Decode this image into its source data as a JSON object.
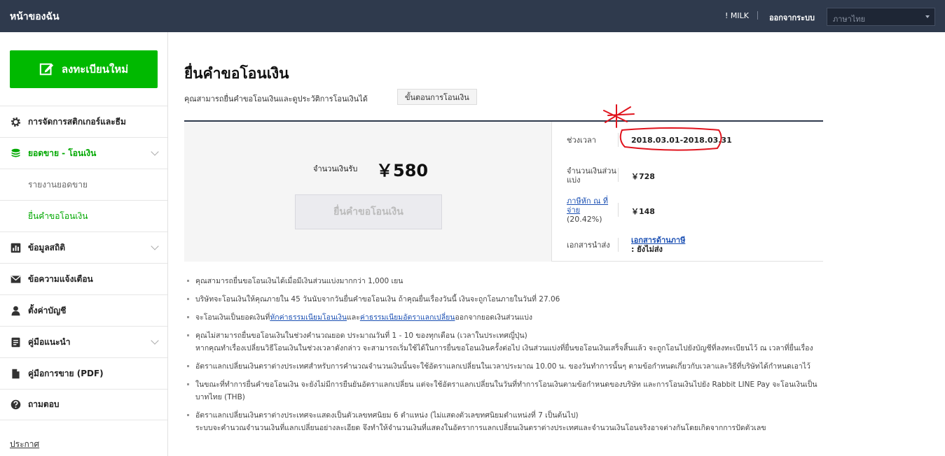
{
  "header": {
    "brand": "หน้าของฉัน",
    "user": "! MILK",
    "logout": "ออกจากระบบ",
    "language_placeholder": "ภาษาไทย"
  },
  "sidebar": {
    "register_label": "ลงทะเบียนใหม่",
    "items": [
      {
        "label": "การจัดการสติกเกอร์และธีม",
        "icon": "gear-icon"
      },
      {
        "label": "ยอดขาย - โอนเงิน",
        "icon": "coins-icon"
      },
      {
        "label": "รายงานยอดขาย"
      },
      {
        "label": "ยื่นคำขอโอนเงิน"
      },
      {
        "label": "ข้อมูลสถิติ",
        "icon": "bar-chart-icon"
      },
      {
        "label": "ข้อความแจ้งเตือน",
        "icon": "envelope-icon"
      },
      {
        "label": "ตั้งค่าบัญชี",
        "icon": "person-icon"
      },
      {
        "label": "คู่มือแนะนำ",
        "icon": "document-icon"
      },
      {
        "label": "คู่มือการขาย (PDF)",
        "icon": "file-icon"
      },
      {
        "label": "ถามตอบ",
        "icon": "question-icon"
      }
    ],
    "announcement": "ประกาศ"
  },
  "main": {
    "title": "ยื่นคำขอโอนเงิน",
    "description": "คุณสามารถยื่นคำขอโอนเงินและดูประวัติการโอนเงินได้",
    "steps_button": "ขั้นตอนการโอนเงิน",
    "summary": {
      "amount_label": "จำนวนเงินรับ",
      "amount_value": "￥580",
      "withdraw_button": "ยื่นคำขอโอนเงิน",
      "period_label": "ช่วงเวลา",
      "period_value": "2018.03.01-2018.03.31",
      "share_label": "จำนวนเงินส่วนแบ่ง",
      "share_value": "￥728",
      "tax_label": "ภาษีหัก ณ ที่จ่าย",
      "tax_rate": "(20.42%)",
      "tax_value": "￥148",
      "documents_label": "เอกสารนำส่ง",
      "documents_link": "เอกสารด้านภาษี",
      "documents_status": ": ยังไม่ส่ง"
    },
    "notes": [
      {
        "text": "คุณสามารถยื่นขอโอนเงินได้เมื่อมีเงินส่วนแบ่งมากกว่า 1,000 เยน"
      },
      {
        "text": "บริษัทจะโอนเงินให้คุณภายใน 45 วันนับจากวันยื่นคำขอโอนเงิน ถ้าคุณยื่นเรื่องวันนี้ เงินจะถูกโอนภายในวันที่ 27.06"
      },
      {
        "pre": "จะโอนเงินเป็นยอดเงินที่",
        "link1": "หักค่าธรรมเนียมโอนเงิน",
        "mid": "และ",
        "link2": "ค่าธรรมเนียมอัตราแลกเปลี่ยน",
        "post": "ออกจากยอดเงินส่วนแบ่ง"
      },
      {
        "line1": "คุณไม่สามารถยื่นขอโอนเงินในช่วงคำนวณยอด ประมาณวันที่ 1 - 10 ของทุกเดือน (เวลาในประเทศญี่ปุ่น)",
        "line2": "หากคุณทำเรื่องเปลี่ยนวิธีโอนเงินในช่วงเวลาดังกล่าว จะสามารถเริ่มใช้ได้ในการยื่นขอโอนเงินครั้งต่อไป เงินส่วนแบ่งที่ยื่นขอโอนเงินเสร็จสิ้นแล้ว จะถูกโอนไปยังบัญชีที่ลงทะเบียนไว้ ณ เวลาที่ยื่นเรื่อง"
      },
      {
        "text": "อัตราแลกเปลี่ยนเงินตราต่างประเทศสำหรับการคำนวณจำนวนเงินนั้นจะใช้อัตราแลกเปลี่ยนในเวลาประมาณ 10.00 น. ของวันทำการนั้นๆ ตามข้อกำหนดเกี่ยวกับเวลาและวิธีที่บริษัทได้กำหนดเอาไว้"
      },
      {
        "text": "ในขณะที่ทำการยื่นคำขอโอนเงิน จะยังไม่มีการยืนยันอัตราแลกเปลี่ยน แต่จะใช้อัตราแลกเปลี่ยนในวันที่ทำการโอนเงินตามข้อกำหนดของบริษัท และการโอนเงินไปยัง Rabbit LINE Pay จะโอนเงินเป็นบาทไทย (THB)"
      },
      {
        "line1": "อัตราแลกเปลี่ยนเงินตราต่างประเทศจะแสดงเป็นตัวเลขทศนิยม 6 ตำแหน่ง (ไม่แสดงตัวเลขทศนิยมตำแหน่งที่ 7 เป็นต้นไป)",
        "line2": "ระบบจะคำนวณจำนวนเงินที่แลกเปลี่ยนอย่างละเอียด จึงทำให้จำนวนเงินที่แสดงในอัตราการแลกเปลี่ยนเงินตราต่างประเทศและจำนวนเงินโอนจริงอาจต่างกันโดยเกิดจากการปัดตัวเลข"
      }
    ]
  }
}
